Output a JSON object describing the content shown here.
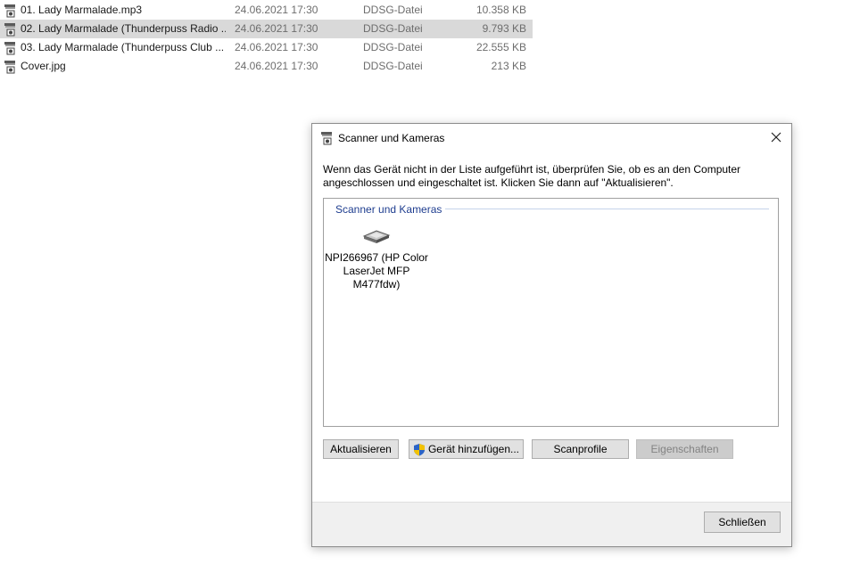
{
  "files": [
    {
      "name": "01. Lady Marmalade.mp3",
      "date": "24.06.2021 17:30",
      "type": "DDSG-Datei",
      "size": "10.358 KB",
      "selected": false
    },
    {
      "name": "02. Lady Marmalade (Thunderpuss Radio ...",
      "date": "24.06.2021 17:30",
      "type": "DDSG-Datei",
      "size": "9.793 KB",
      "selected": true
    },
    {
      "name": "03. Lady Marmalade (Thunderpuss Club ...",
      "date": "24.06.2021 17:30",
      "type": "DDSG-Datei",
      "size": "22.555 KB",
      "selected": false
    },
    {
      "name": "Cover.jpg",
      "date": "24.06.2021 17:30",
      "type": "DDSG-Datei",
      "size": "213 KB",
      "selected": false
    }
  ],
  "dialog": {
    "title": "Scanner und Kameras",
    "description": "Wenn das Gerät nicht in der Liste aufgeführt ist, überprüfen Sie, ob es an den Computer angeschlossen und eingeschaltet ist. Klicken Sie dann auf \"Aktualisieren\".",
    "group_header": "Scanner und Kameras",
    "device_label": "NPI266967 (HP Color LaserJet MFP M477fdw)",
    "buttons": {
      "refresh": "Aktualisieren",
      "add_device": "Gerät hinzufügen...",
      "scan_profiles": "Scanprofile",
      "properties": "Eigenschaften",
      "close": "Schließen"
    }
  }
}
